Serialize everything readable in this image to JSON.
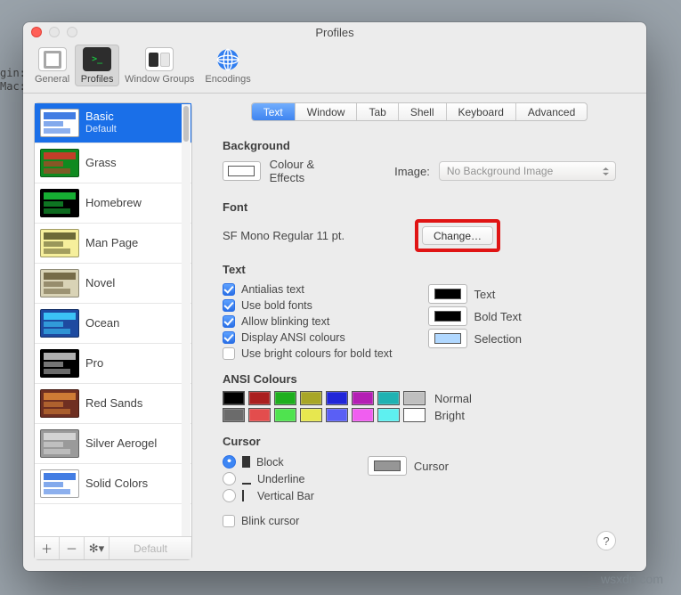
{
  "terminal_behind": "gin:\nMac:",
  "window": {
    "title": "Profiles"
  },
  "toolbar": {
    "general": "General",
    "profiles": "Profiles",
    "window_groups": "Window Groups",
    "encodings": "Encodings"
  },
  "sidebar": {
    "items": [
      {
        "name": "Basic",
        "sub": "Default",
        "thumb_bg": "#ffffff",
        "accent": "#2f6fe0"
      },
      {
        "name": "Grass",
        "thumb_bg": "#0f8a1f",
        "accent": "#d6352a"
      },
      {
        "name": "Homebrew",
        "thumb_bg": "#000000",
        "accent": "#18c139"
      },
      {
        "name": "Man Page",
        "thumb_bg": "#f6ef9c",
        "accent": "#5e5b2e"
      },
      {
        "name": "Novel",
        "thumb_bg": "#d9d3b6",
        "accent": "#6a5f3c"
      },
      {
        "name": "Ocean",
        "thumb_bg": "#1e4aa0",
        "accent": "#3ed0ff"
      },
      {
        "name": "Pro",
        "thumb_bg": "#000000",
        "accent": "#c3c3c3"
      },
      {
        "name": "Red Sands",
        "thumb_bg": "#6f2f21",
        "accent": "#d88437"
      },
      {
        "name": "Silver Aerogel",
        "thumb_bg": "#9a9a9a",
        "accent": "#d9d9d9"
      },
      {
        "name": "Solid Colors",
        "thumb_bg": "#ffffff",
        "accent": "#2f6fe0"
      }
    ],
    "footer": {
      "default_label": "Default"
    }
  },
  "tabs": [
    "Text",
    "Window",
    "Tab",
    "Shell",
    "Keyboard",
    "Advanced"
  ],
  "active_tab": "Text",
  "background": {
    "section": "Background",
    "colour_label": "Colour & Effects",
    "image_label": "Image:",
    "image_value": "No Background Image"
  },
  "font": {
    "section": "Font",
    "current": "SF Mono Regular 11 pt.",
    "change_label": "Change…"
  },
  "text": {
    "section": "Text",
    "antialias": "Antialias text",
    "bold": "Use bold fonts",
    "blinking": "Allow blinking text",
    "ansi": "Display ANSI colours",
    "bright_bold": "Use bright colours for bold text",
    "text_label": "Text",
    "bold_label": "Bold Text",
    "selection_label": "Selection",
    "text_color": "#000000",
    "bold_color": "#000000",
    "selection_color": "#b1d8ff"
  },
  "ansi": {
    "section": "ANSI Colours",
    "normal_label": "Normal",
    "bright_label": "Bright",
    "normal": [
      "#000000",
      "#aa1f1f",
      "#1eaf1e",
      "#a8a626",
      "#2126d8",
      "#b41fb4",
      "#1fb2b2",
      "#bfbfbf"
    ],
    "bright": [
      "#6b6b6b",
      "#e34d4d",
      "#4fe34f",
      "#e7e74f",
      "#5a5ff5",
      "#f05ef0",
      "#5ef0f0",
      "#ffffff"
    ]
  },
  "cursor": {
    "section": "Cursor",
    "block": "Block",
    "underline": "Underline",
    "vbar": "Vertical Bar",
    "blink": "Blink cursor",
    "cursor_label": "Cursor",
    "cursor_color": "#969696"
  },
  "watermark": "wsxdn.com"
}
